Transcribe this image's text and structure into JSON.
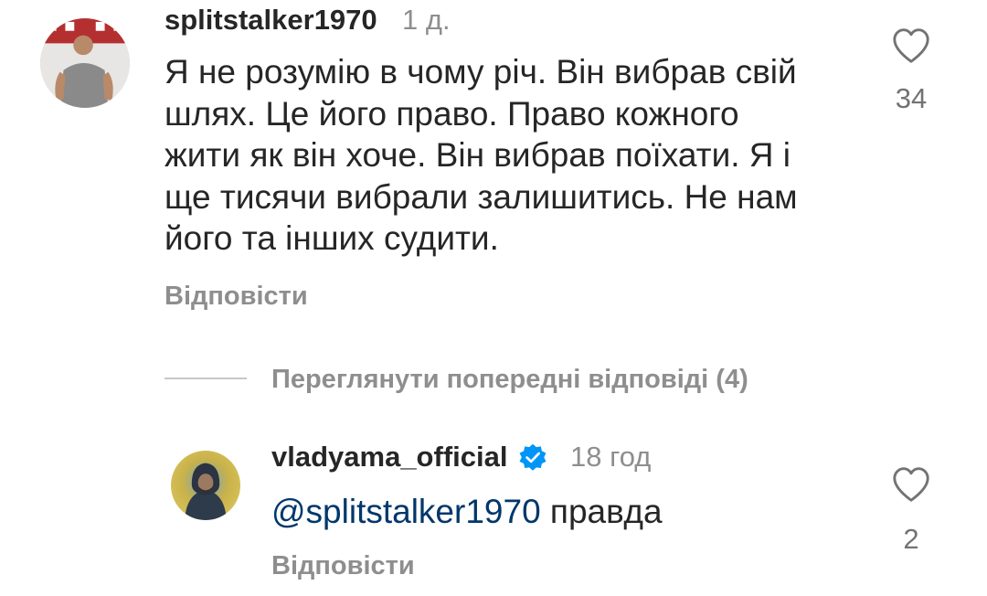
{
  "comment": {
    "username": "splitstalker1970",
    "time": "1 д.",
    "text_lines": [
      "Я не розумію в чому річ. Він вибрав свій",
      "шлях. Це його право. Право кожного",
      "жити як він хоче. Він вибрав поїхати. Я і",
      "ще тисячи вибрали залишитись. Не нам",
      "його та інших судити."
    ],
    "like_count": "34",
    "reply_label": "Відповісти"
  },
  "view_previous_replies": "Переглянути попередні відповіді (4)",
  "reply": {
    "username": "vladyama_official",
    "verified": true,
    "time": "18 год",
    "mention": "@splitstalker1970",
    "text": " правда",
    "like_count": "2",
    "reply_label": "Відповісти"
  },
  "colors": {
    "text_primary": "#262626",
    "text_secondary": "#8e8e8e",
    "mention": "#00376b",
    "verified_badge": "#0095f6"
  },
  "icons": {
    "like": "heart-outline-icon",
    "verified": "verified-badge-icon"
  }
}
